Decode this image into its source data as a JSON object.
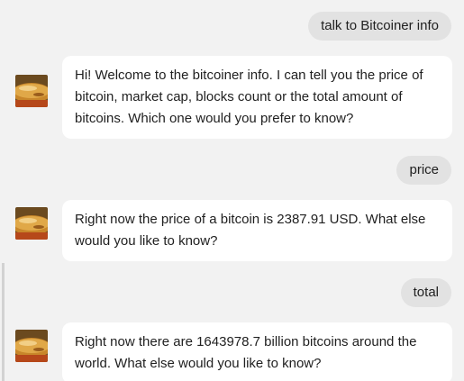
{
  "conversation": {
    "messages": [
      {
        "role": "user",
        "text": "talk to Bitcoiner info"
      },
      {
        "role": "agent",
        "avatar_icon": "bitcoin-coin-avatar",
        "text": "Hi! Welcome to the bitcoiner info. I can tell you the price of bitcoin, market cap, blocks count or the total amount of bitcoins. Which one would you prefer to know?"
      },
      {
        "role": "user",
        "text": "price"
      },
      {
        "role": "agent",
        "avatar_icon": "bitcoin-coin-avatar",
        "text": "Right now the price of a bitcoin is 2387.91 USD. What else would you like to know?"
      },
      {
        "role": "user",
        "text": "total"
      },
      {
        "role": "agent",
        "avatar_icon": "bitcoin-coin-avatar",
        "text": "Right now there are 1643978.7 billion bitcoins around the world. What else would you like to know?"
      }
    ]
  },
  "colors": {
    "background": "#f2f2f2",
    "user_bubble": "#e2e2e2",
    "agent_bubble": "#ffffff",
    "text": "#212121",
    "coin_gold": "#c8862a"
  }
}
